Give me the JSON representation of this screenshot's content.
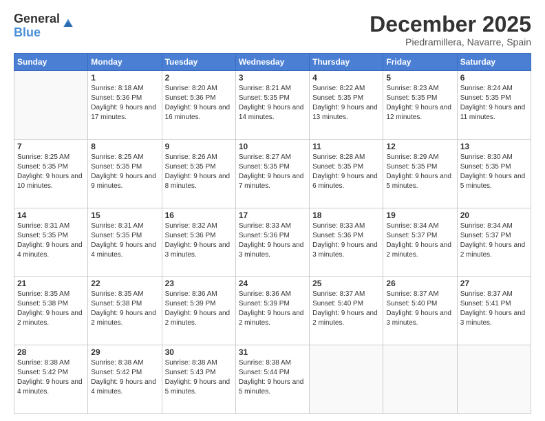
{
  "logo": {
    "general": "General",
    "blue": "Blue"
  },
  "title": "December 2025",
  "location": "Piedramillera, Navarre, Spain",
  "weekdays": [
    "Sunday",
    "Monday",
    "Tuesday",
    "Wednesday",
    "Thursday",
    "Friday",
    "Saturday"
  ],
  "weeks": [
    [
      {
        "day": "",
        "sunrise": "",
        "sunset": "",
        "daylight": ""
      },
      {
        "day": "1",
        "sunrise": "Sunrise: 8:18 AM",
        "sunset": "Sunset: 5:36 PM",
        "daylight": "Daylight: 9 hours and 17 minutes."
      },
      {
        "day": "2",
        "sunrise": "Sunrise: 8:20 AM",
        "sunset": "Sunset: 5:36 PM",
        "daylight": "Daylight: 9 hours and 16 minutes."
      },
      {
        "day": "3",
        "sunrise": "Sunrise: 8:21 AM",
        "sunset": "Sunset: 5:35 PM",
        "daylight": "Daylight: 9 hours and 14 minutes."
      },
      {
        "day": "4",
        "sunrise": "Sunrise: 8:22 AM",
        "sunset": "Sunset: 5:35 PM",
        "daylight": "Daylight: 9 hours and 13 minutes."
      },
      {
        "day": "5",
        "sunrise": "Sunrise: 8:23 AM",
        "sunset": "Sunset: 5:35 PM",
        "daylight": "Daylight: 9 hours and 12 minutes."
      },
      {
        "day": "6",
        "sunrise": "Sunrise: 8:24 AM",
        "sunset": "Sunset: 5:35 PM",
        "daylight": "Daylight: 9 hours and 11 minutes."
      }
    ],
    [
      {
        "day": "7",
        "sunrise": "Sunrise: 8:25 AM",
        "sunset": "Sunset: 5:35 PM",
        "daylight": "Daylight: 9 hours and 10 minutes."
      },
      {
        "day": "8",
        "sunrise": "Sunrise: 8:25 AM",
        "sunset": "Sunset: 5:35 PM",
        "daylight": "Daylight: 9 hours and 9 minutes."
      },
      {
        "day": "9",
        "sunrise": "Sunrise: 8:26 AM",
        "sunset": "Sunset: 5:35 PM",
        "daylight": "Daylight: 9 hours and 8 minutes."
      },
      {
        "day": "10",
        "sunrise": "Sunrise: 8:27 AM",
        "sunset": "Sunset: 5:35 PM",
        "daylight": "Daylight: 9 hours and 7 minutes."
      },
      {
        "day": "11",
        "sunrise": "Sunrise: 8:28 AM",
        "sunset": "Sunset: 5:35 PM",
        "daylight": "Daylight: 9 hours and 6 minutes."
      },
      {
        "day": "12",
        "sunrise": "Sunrise: 8:29 AM",
        "sunset": "Sunset: 5:35 PM",
        "daylight": "Daylight: 9 hours and 5 minutes."
      },
      {
        "day": "13",
        "sunrise": "Sunrise: 8:30 AM",
        "sunset": "Sunset: 5:35 PM",
        "daylight": "Daylight: 9 hours and 5 minutes."
      }
    ],
    [
      {
        "day": "14",
        "sunrise": "Sunrise: 8:31 AM",
        "sunset": "Sunset: 5:35 PM",
        "daylight": "Daylight: 9 hours and 4 minutes."
      },
      {
        "day": "15",
        "sunrise": "Sunrise: 8:31 AM",
        "sunset": "Sunset: 5:35 PM",
        "daylight": "Daylight: 9 hours and 4 minutes."
      },
      {
        "day": "16",
        "sunrise": "Sunrise: 8:32 AM",
        "sunset": "Sunset: 5:36 PM",
        "daylight": "Daylight: 9 hours and 3 minutes."
      },
      {
        "day": "17",
        "sunrise": "Sunrise: 8:33 AM",
        "sunset": "Sunset: 5:36 PM",
        "daylight": "Daylight: 9 hours and 3 minutes."
      },
      {
        "day": "18",
        "sunrise": "Sunrise: 8:33 AM",
        "sunset": "Sunset: 5:36 PM",
        "daylight": "Daylight: 9 hours and 3 minutes."
      },
      {
        "day": "19",
        "sunrise": "Sunrise: 8:34 AM",
        "sunset": "Sunset: 5:37 PM",
        "daylight": "Daylight: 9 hours and 2 minutes."
      },
      {
        "day": "20",
        "sunrise": "Sunrise: 8:34 AM",
        "sunset": "Sunset: 5:37 PM",
        "daylight": "Daylight: 9 hours and 2 minutes."
      }
    ],
    [
      {
        "day": "21",
        "sunrise": "Sunrise: 8:35 AM",
        "sunset": "Sunset: 5:38 PM",
        "daylight": "Daylight: 9 hours and 2 minutes."
      },
      {
        "day": "22",
        "sunrise": "Sunrise: 8:35 AM",
        "sunset": "Sunset: 5:38 PM",
        "daylight": "Daylight: 9 hours and 2 minutes."
      },
      {
        "day": "23",
        "sunrise": "Sunrise: 8:36 AM",
        "sunset": "Sunset: 5:39 PM",
        "daylight": "Daylight: 9 hours and 2 minutes."
      },
      {
        "day": "24",
        "sunrise": "Sunrise: 8:36 AM",
        "sunset": "Sunset: 5:39 PM",
        "daylight": "Daylight: 9 hours and 2 minutes."
      },
      {
        "day": "25",
        "sunrise": "Sunrise: 8:37 AM",
        "sunset": "Sunset: 5:40 PM",
        "daylight": "Daylight: 9 hours and 2 minutes."
      },
      {
        "day": "26",
        "sunrise": "Sunrise: 8:37 AM",
        "sunset": "Sunset: 5:40 PM",
        "daylight": "Daylight: 9 hours and 3 minutes."
      },
      {
        "day": "27",
        "sunrise": "Sunrise: 8:37 AM",
        "sunset": "Sunset: 5:41 PM",
        "daylight": "Daylight: 9 hours and 3 minutes."
      }
    ],
    [
      {
        "day": "28",
        "sunrise": "Sunrise: 8:38 AM",
        "sunset": "Sunset: 5:42 PM",
        "daylight": "Daylight: 9 hours and 4 minutes."
      },
      {
        "day": "29",
        "sunrise": "Sunrise: 8:38 AM",
        "sunset": "Sunset: 5:42 PM",
        "daylight": "Daylight: 9 hours and 4 minutes."
      },
      {
        "day": "30",
        "sunrise": "Sunrise: 8:38 AM",
        "sunset": "Sunset: 5:43 PM",
        "daylight": "Daylight: 9 hours and 5 minutes."
      },
      {
        "day": "31",
        "sunrise": "Sunrise: 8:38 AM",
        "sunset": "Sunset: 5:44 PM",
        "daylight": "Daylight: 9 hours and 5 minutes."
      },
      {
        "day": "",
        "sunrise": "",
        "sunset": "",
        "daylight": ""
      },
      {
        "day": "",
        "sunrise": "",
        "sunset": "",
        "daylight": ""
      },
      {
        "day": "",
        "sunrise": "",
        "sunset": "",
        "daylight": ""
      }
    ]
  ]
}
